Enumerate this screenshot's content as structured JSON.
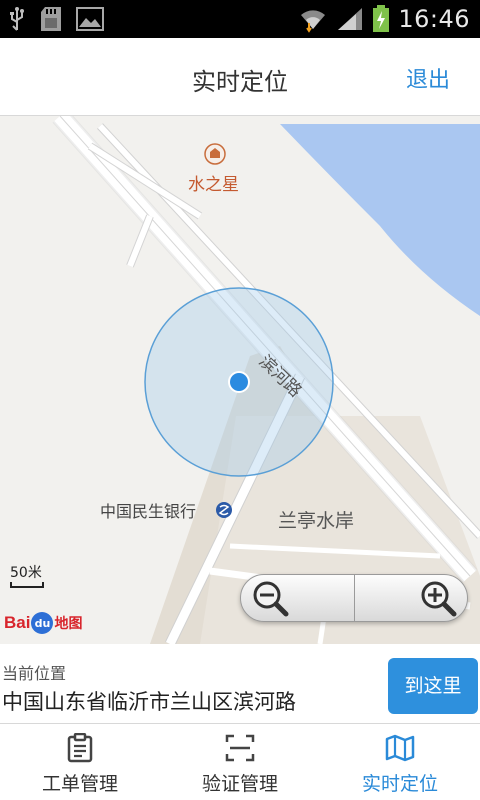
{
  "status_bar": {
    "time": "16:46",
    "icons": [
      "usb-icon",
      "sd-card-icon",
      "image-icon",
      "wifi-icon",
      "signal-icon",
      "battery-charging-icon"
    ]
  },
  "header": {
    "title": "实时定位",
    "exit_label": "退出"
  },
  "map": {
    "poi_water_star": "水之星",
    "road_name": "滨河路",
    "bank_name": "中国民生银行",
    "residential_name": "兰亭水岸",
    "scale_label": "50米",
    "logo_text_bai": "Bai",
    "logo_text_du": "du",
    "logo_text_ditu": "地图",
    "accuracy_circle_color": "#5a9fd6",
    "location_dot_color": "#2b8be0",
    "water_color": "#a9c7f2"
  },
  "location": {
    "label": "当前位置",
    "address": "中国山东省临沂市兰山区滨河路",
    "goto_label": "到这里"
  },
  "tabs": [
    {
      "label": "工单管理",
      "icon": "clipboard-icon",
      "active": false
    },
    {
      "label": "验证管理",
      "icon": "scan-frame-icon",
      "active": false
    },
    {
      "label": "实时定位",
      "icon": "map-icon",
      "active": true
    }
  ],
  "colors": {
    "accent": "#2a8ad8",
    "button": "#2e90dd"
  }
}
